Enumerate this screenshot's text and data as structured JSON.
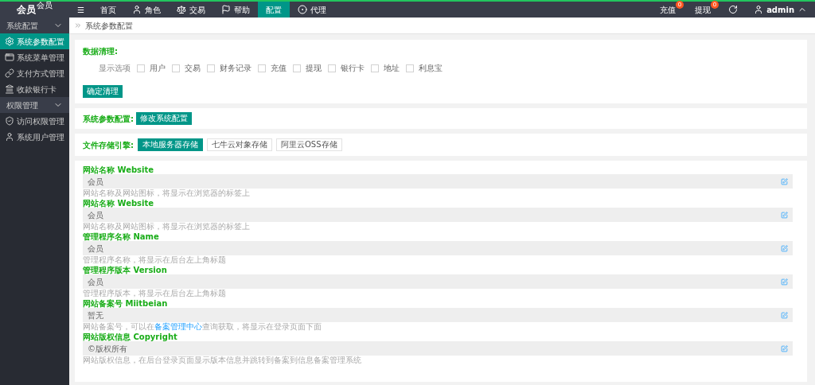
{
  "logo": {
    "title": "会员",
    "sup": "会员"
  },
  "nav": [
    {
      "label": "☰",
      "selected": false
    },
    {
      "label": "首页",
      "selected": false
    },
    {
      "label": "角色",
      "selected": false
    },
    {
      "label": "交易",
      "selected": false
    },
    {
      "label": "帮助",
      "selected": false
    },
    {
      "label": "配置",
      "selected": true
    },
    {
      "label": "代理",
      "selected": false
    }
  ],
  "top_right": {
    "items": [
      {
        "label": "充值",
        "badge": "0"
      },
      {
        "label": "提现",
        "badge": "0"
      }
    ],
    "user": "admin"
  },
  "sidebar": [
    {
      "label": "系统配置",
      "expanded": true,
      "children": [
        {
          "label": "系统参数配置",
          "selected": true
        },
        {
          "label": "系统菜单管理",
          "selected": false
        },
        {
          "label": "支付方式管理",
          "selected": false
        },
        {
          "label": "收款银行卡",
          "selected": false
        }
      ]
    },
    {
      "label": "权限管理",
      "expanded": true,
      "children": [
        {
          "label": "访问权限管理",
          "selected": false
        },
        {
          "label": "系统用户管理",
          "selected": false
        }
      ]
    }
  ],
  "breadcrumb": "系统参数配置",
  "cleanup": {
    "title": "数据清理:",
    "options_label": "显示选项",
    "options": [
      {
        "label": "用户",
        "checked": false
      },
      {
        "label": "交易",
        "checked": false
      },
      {
        "label": "财务记录",
        "checked": false
      },
      {
        "label": "充值",
        "checked": false
      },
      {
        "label": "提现",
        "checked": false
      },
      {
        "label": "银行卡",
        "checked": false
      },
      {
        "label": "地址",
        "checked": false
      },
      {
        "label": "利息宝",
        "checked": false
      }
    ],
    "button": "确定清理"
  },
  "system_config": {
    "label": "系统参数配置:",
    "button": "修改系统配置"
  },
  "storage": {
    "label": "文件存储引擎:",
    "options": [
      {
        "label": "本地服务器存储",
        "selected": true
      },
      {
        "label": "七牛云对象存储",
        "selected": false
      },
      {
        "label": "阿里云OSS存储",
        "selected": false
      }
    ]
  },
  "fields": [
    {
      "label": "网站名称 Website",
      "value": "会员",
      "hint": "网站名称及网站图标，将显示在浏览器的标签上"
    },
    {
      "label": "网站名称 Website",
      "value": "会员",
      "hint": "网站名称及网站图标，将显示在浏览器的标签上"
    },
    {
      "label": "管理程序名称 Name",
      "value": "会员",
      "hint": "管理程序名称，将显示在后台左上角标题"
    },
    {
      "label": "管理程序版本 Version",
      "value": "会员",
      "hint": "管理程序版本，将显示在后台左上角标题"
    },
    {
      "label": "网站备案号 Miitbeian",
      "value": "暂无",
      "hint": "网站备案号，可以在",
      "link": "备案管理中心",
      "hint_after": "查询获取，将显示在登录页面下面"
    },
    {
      "label": "网站版权信息 Copyright",
      "value": "©版权所有",
      "hint": "网站版权信息，在后台登录页面显示版本信息并跳转到备案到信息备案管理系统"
    }
  ]
}
